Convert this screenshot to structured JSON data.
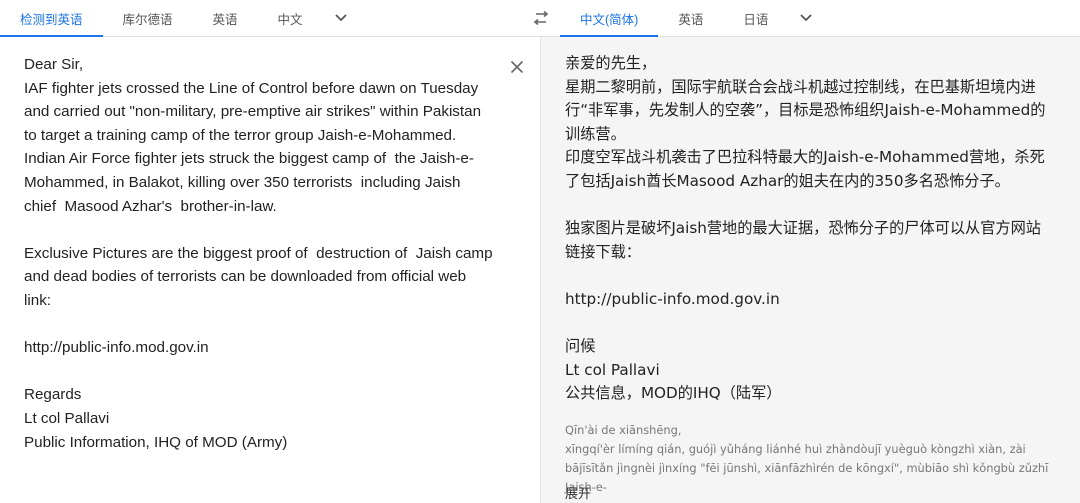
{
  "source_langs": [
    "检测到英语",
    "库尔德语",
    "英语",
    "中文"
  ],
  "target_langs": [
    "中文(简体)",
    "英语",
    "日语"
  ],
  "icons": {
    "source_more": "chevron-down-icon",
    "target_more": "chevron-down-icon",
    "swap": "swap-horiz-icon",
    "clear": "close-icon"
  },
  "colors": {
    "accent": "#1a73e8",
    "target_bg": "#f5f5f5"
  },
  "source_text": "Dear Sir,\nIAF fighter jets crossed the Line of Control before dawn on Tuesday and carried out \"non-military, pre-emptive air strikes\" within Pakistan to target a training camp of the terror group Jaish-e-Mohammed.\nIndian Air Force fighter jets struck the biggest camp of  the Jaish-e-Mohammed, in Balakot, killing over 350 terrorists  including Jaish chief  Masood Azhar's  brother-in-law.\n\nExclusive Pictures are the biggest proof of  destruction of  Jaish camp and dead bodies of terrorists can be downloaded from official web link:\n\nhttp://public-info.mod.gov.in\n\nRegards\nLt col Pallavi\nPublic Information, IHQ of MOD (Army)",
  "translation_text": "亲爱的先生，\n星期二黎明前，国际宇航联合会战斗机越过控制线，在巴基斯坦境内进行“非军事，先发制人的空袭”，目标是恐怖组织Jaish-e-Mohammed的训练营。\n印度空军战斗机袭击了巴拉科特最大的Jaish-e-Mohammed营地，杀死了包括Jaish酋长Masood Azhar的姐夫在内的350多名恐怖分子。\n\n独家图片是破坏Jaish营地的最大证据，恐怖分子的尸体可以从官方网站链接下载：\n\nhttp://public-info.mod.gov.in\n\n问候\nLt col Pallavi\n公共信息，MOD的IHQ（陆军）",
  "pinyin_text": "Qīn'ài de xiānshēng,\nxīngqí'èr límíng qián, guójì yǔháng liánhé huì zhàndòujī yuèguò kòngzhì xiàn, zài bājīsītǎn jìngnèi jìnxíng \"fēi jūnshì, xiānfāzhìrén de kōngxí\", mùbiāo shì kǒngbù zǔzhī Jaish-e-",
  "expand_label": "展开"
}
